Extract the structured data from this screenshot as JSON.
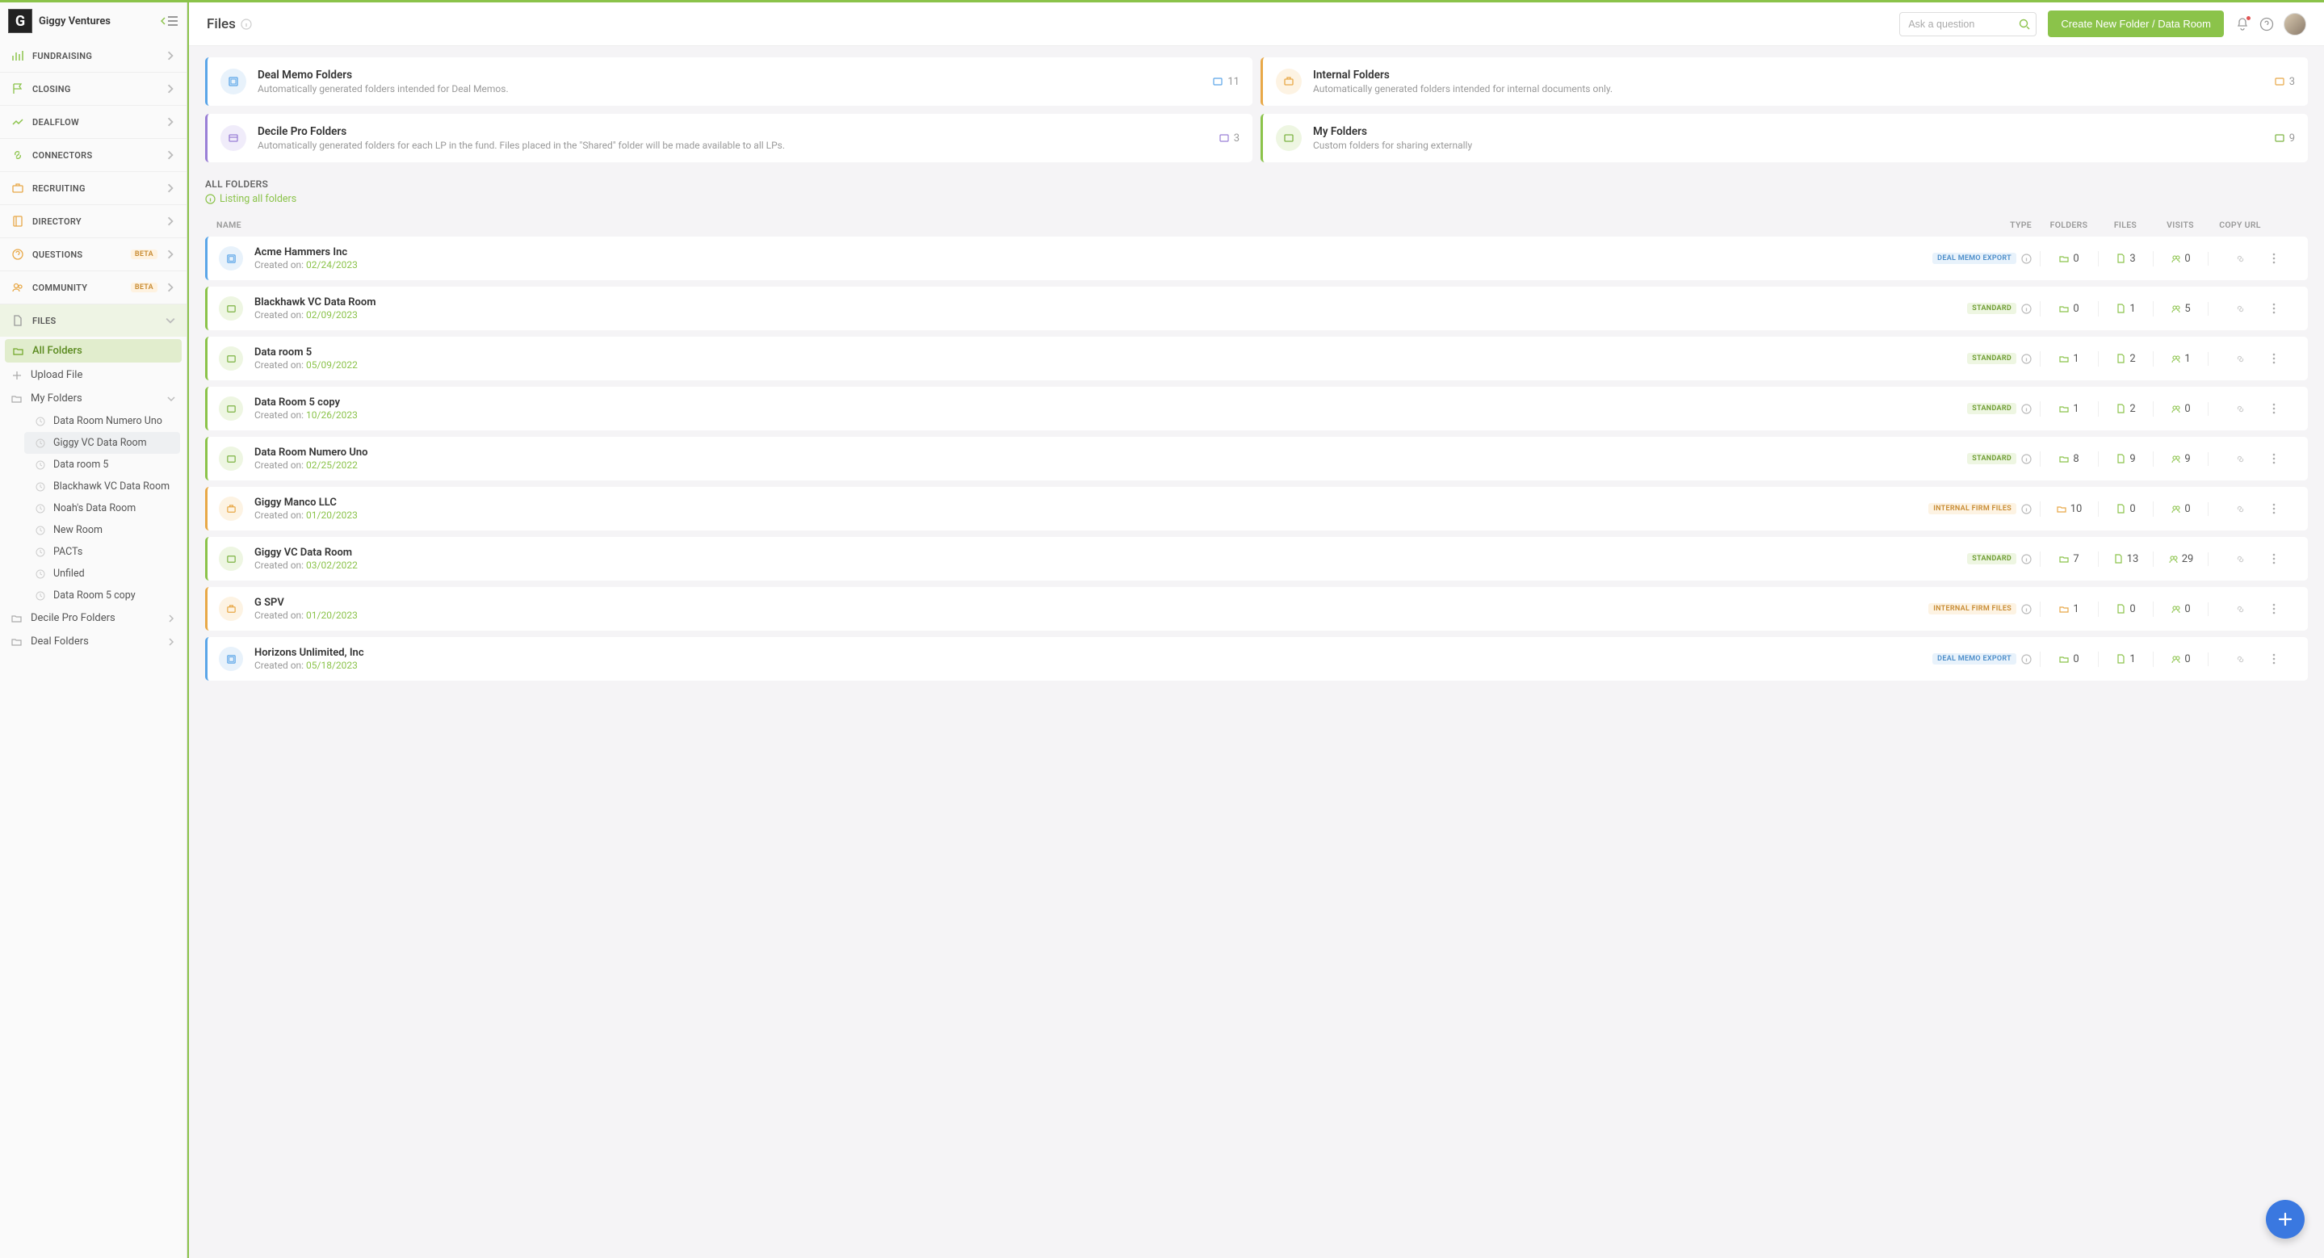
{
  "org": {
    "name": "Giggy Ventures"
  },
  "nav": {
    "fundraising": "FUNDRAISING",
    "closing": "CLOSING",
    "dealflow": "DEALFLOW",
    "connectors": "CONNECTORS",
    "recruiting": "RECRUITING",
    "directory": "DIRECTORY",
    "questions": "QUESTIONS",
    "community": "COMMUNITY",
    "files": "FILES",
    "beta": "BETA"
  },
  "subnav": {
    "all_folders": "All Folders",
    "upload_file": "Upload File",
    "my_folders": "My Folders",
    "decile_pro": "Decile Pro Folders",
    "deal_folders": "Deal Folders",
    "nested": [
      "Data Room Numero Uno",
      "Giggy VC Data Room",
      "Data room 5",
      "Blackhawk VC Data Room",
      "Noah's Data Room",
      "New Room",
      "PACTs",
      "Unfiled",
      "Data Room 5 copy"
    ]
  },
  "header": {
    "title": "Files",
    "search_placeholder": "Ask a question",
    "create_btn": "Create New Folder / Data Room"
  },
  "cards": {
    "deal_memo": {
      "title": "Deal Memo Folders",
      "desc": "Automatically generated folders intended for Deal Memos.",
      "count": "11"
    },
    "internal": {
      "title": "Internal Folders",
      "desc": "Automatically generated folders intended for internal documents only.",
      "count": "3"
    },
    "decile": {
      "title": "Decile Pro Folders",
      "desc": "Automatically generated folders for each LP in the fund. Files placed in the \"Shared\" folder will be made available to all LPs.",
      "count": "3"
    },
    "my": {
      "title": "My Folders",
      "desc": "Custom folders for sharing externally",
      "count": "9"
    }
  },
  "section": {
    "label": "ALL FOLDERS",
    "note": "Listing all folders"
  },
  "columns": {
    "name": "NAME",
    "type": "TYPE",
    "folders": "FOLDERS",
    "files": "FILES",
    "visits": "VISITS",
    "copy": "COPY URL"
  },
  "row_labels": {
    "created_on": "Created on: "
  },
  "type_labels": {
    "deal_memo": "DEAL MEMO EXPORT",
    "standard": "STANDARD",
    "internal": "INTERNAL FIRM FILES"
  },
  "rows": [
    {
      "name": "Acme Hammers Inc",
      "date": "02/24/2023",
      "type": "deal_memo",
      "folders": "0",
      "files": "3",
      "visits": "0",
      "accent": "blue"
    },
    {
      "name": "Blackhawk VC Data Room",
      "date": "02/09/2023",
      "type": "standard",
      "folders": "0",
      "files": "1",
      "visits": "5",
      "accent": "green"
    },
    {
      "name": "Data room 5",
      "date": "05/09/2022",
      "type": "standard",
      "folders": "1",
      "files": "2",
      "visits": "1",
      "accent": "green"
    },
    {
      "name": "Data Room 5 copy",
      "date": "10/26/2023",
      "type": "standard",
      "folders": "1",
      "files": "2",
      "visits": "0",
      "accent": "green"
    },
    {
      "name": "Data Room Numero Uno",
      "date": "02/25/2022",
      "type": "standard",
      "folders": "8",
      "files": "9",
      "visits": "9",
      "accent": "green"
    },
    {
      "name": "Giggy Manco LLC",
      "date": "01/20/2023",
      "type": "internal",
      "folders": "10",
      "files": "0",
      "visits": "0",
      "accent": "orange"
    },
    {
      "name": "Giggy VC Data Room",
      "date": "03/02/2022",
      "type": "standard",
      "folders": "7",
      "files": "13",
      "visits": "29",
      "accent": "green"
    },
    {
      "name": "G SPV",
      "date": "01/20/2023",
      "type": "internal",
      "folders": "1",
      "files": "0",
      "visits": "0",
      "accent": "orange"
    },
    {
      "name": "Horizons Unlimited, Inc",
      "date": "05/18/2023",
      "type": "deal_memo",
      "folders": "0",
      "files": "1",
      "visits": "0",
      "accent": "blue"
    }
  ]
}
